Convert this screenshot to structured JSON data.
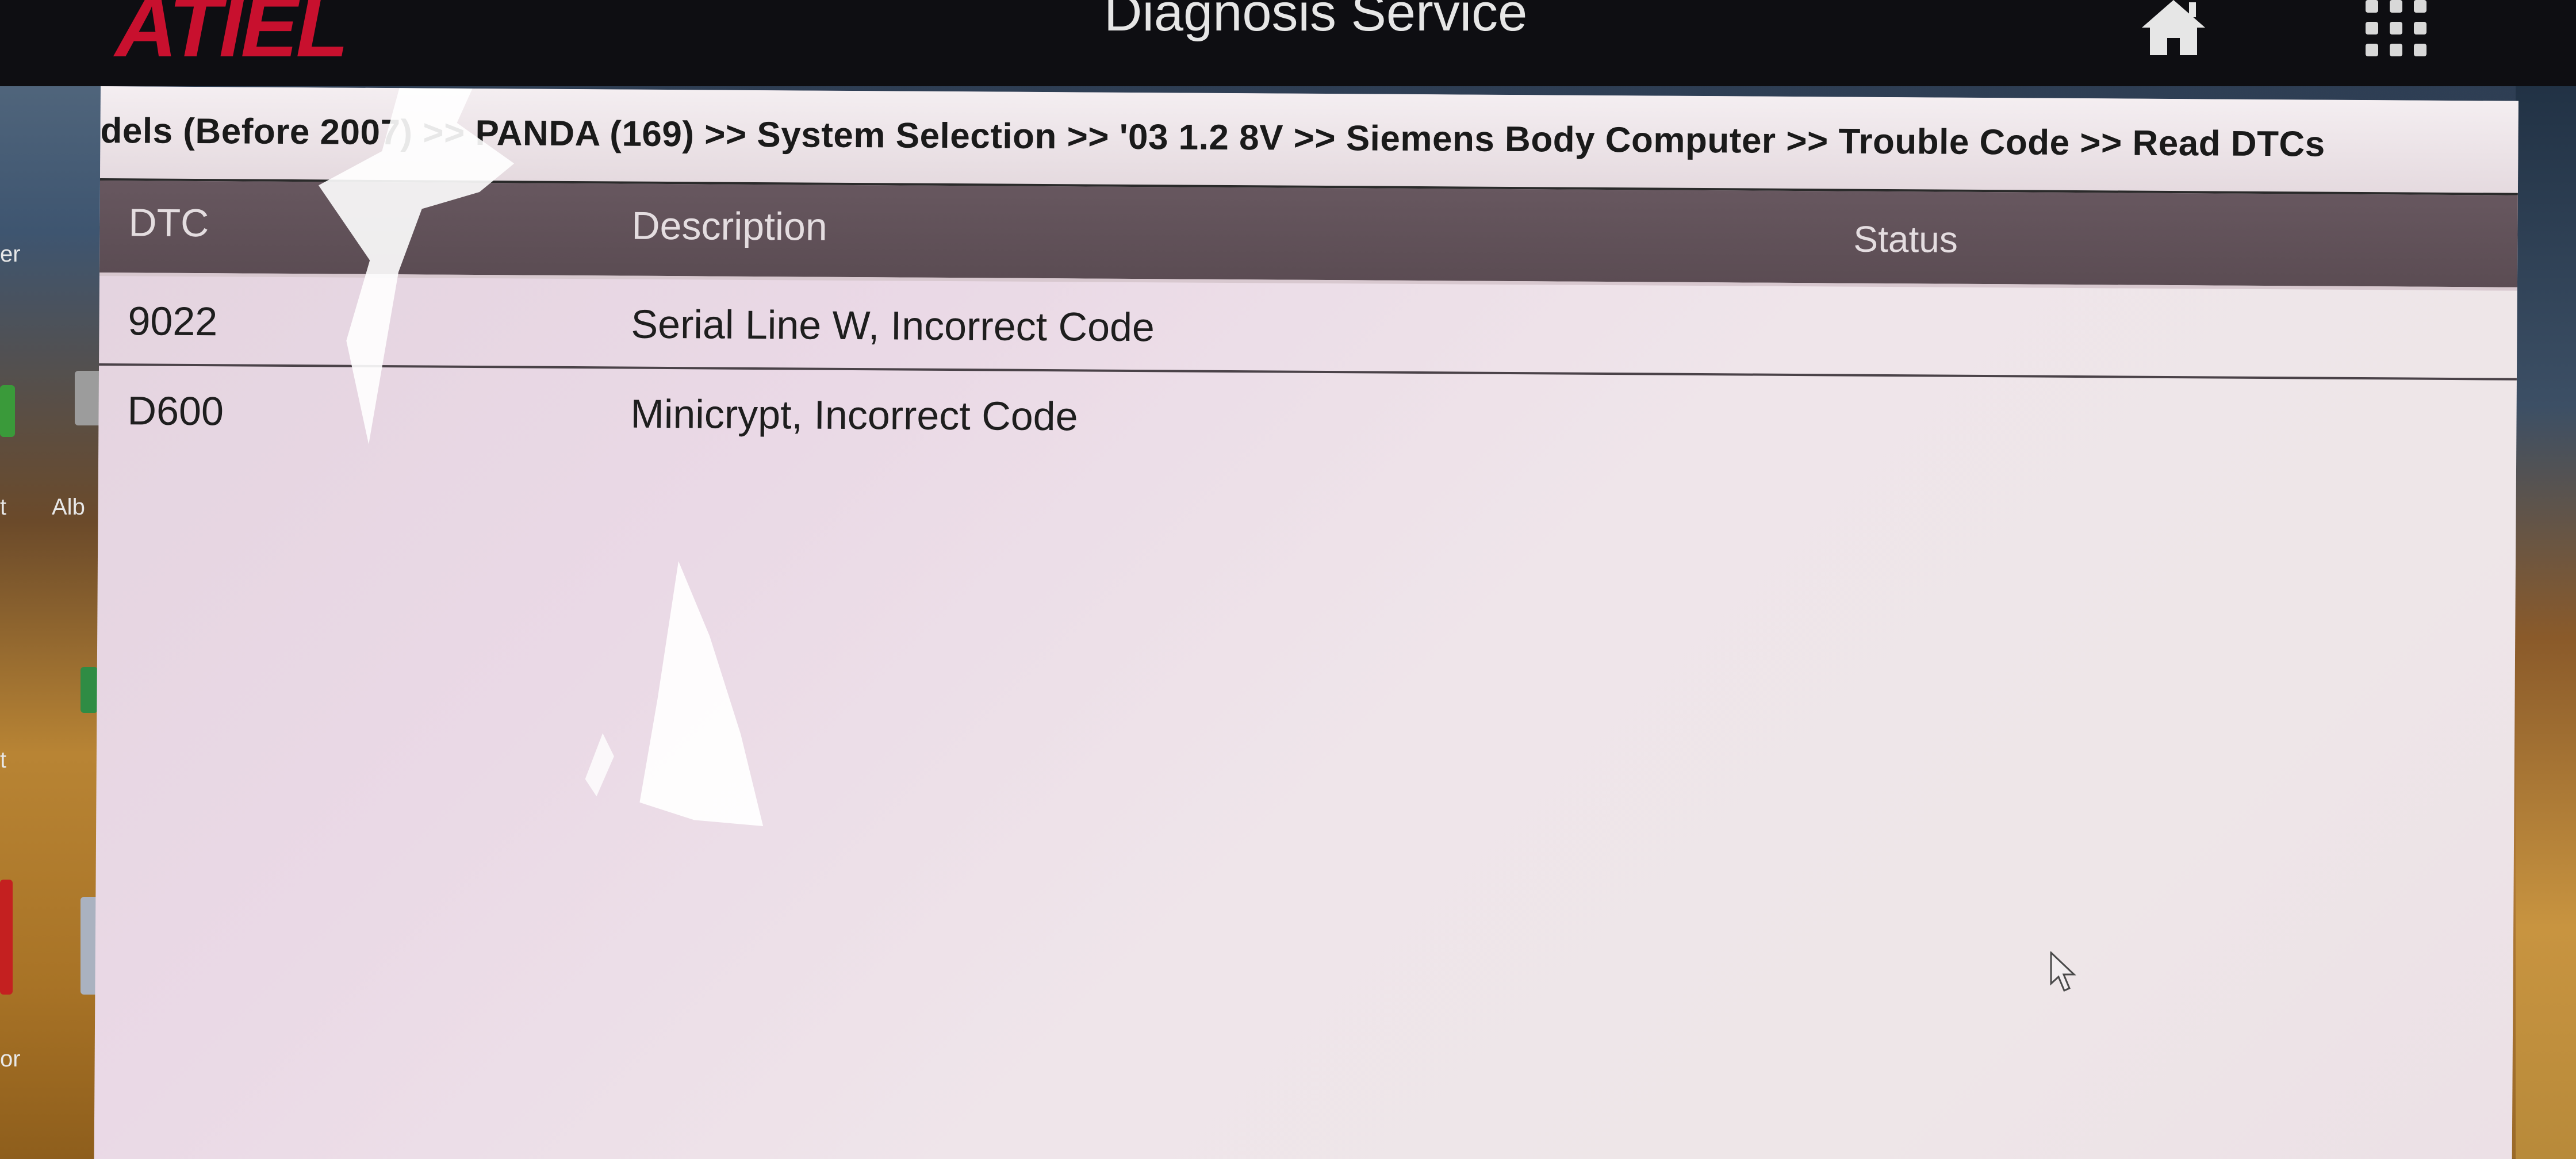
{
  "app": {
    "logo_text": "ATIEL",
    "title": "Diagnosis Service",
    "home_label": "home",
    "menu_label": "menu"
  },
  "breadcrumb": {
    "items": [
      "dels (Before 2007)",
      "PANDA (169)",
      "System Selection",
      "'03 1.2 8V",
      "Siemens Body Computer",
      "Trouble Code",
      "Read DTCs"
    ],
    "separator": ">>"
  },
  "table": {
    "columns": [
      "DTC",
      "Description",
      "Status"
    ],
    "rows": [
      {
        "dtc": "9022",
        "description": "Serial Line W, Incorrect Code",
        "status": ""
      },
      {
        "dtc": "D600",
        "description": "Minicrypt, Incorrect Code",
        "status": ""
      }
    ]
  },
  "desktop": {
    "labels": [
      "er",
      "t",
      "Alb",
      "t",
      "or"
    ]
  },
  "colors": {
    "logo_red": "#c8102e",
    "header_bg": "#5b4c53",
    "title_bar_bg": "#0e0e12"
  },
  "icons": {
    "home": "home-icon",
    "grid": "grid-menu-icon",
    "cursor": "mouse-cursor-icon"
  }
}
